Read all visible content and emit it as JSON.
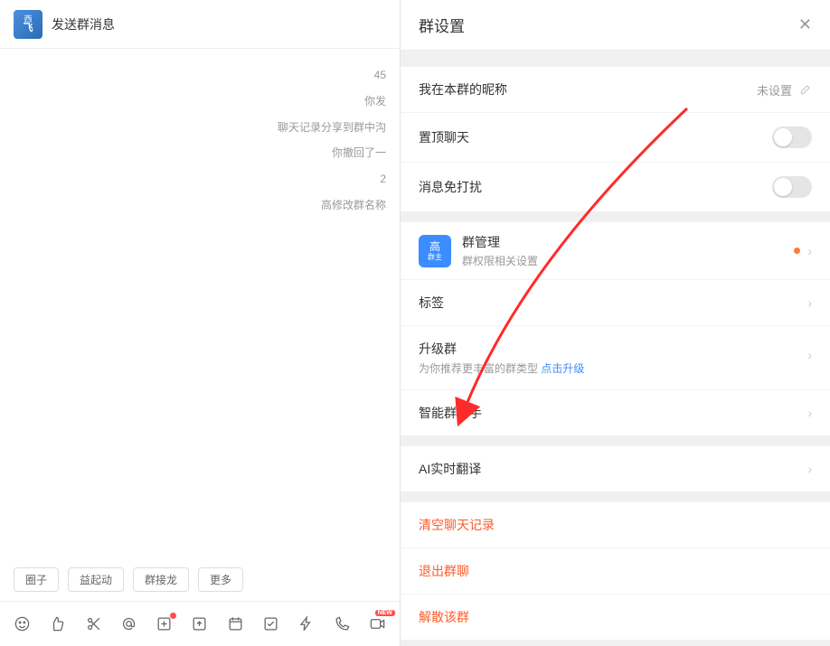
{
  "chat": {
    "title": "发送群消息",
    "avatar_lines": [
      "西",
      "飞"
    ],
    "messages": [
      "45",
      "你发",
      "聊天记录分享到群中沟",
      "你撤回了一",
      "2",
      "高修改群名称"
    ],
    "chips": [
      "圈子",
      "益起动",
      "群接龙",
      "更多"
    ]
  },
  "panel": {
    "title": "群设置",
    "nickname": {
      "label": "我在本群的昵称",
      "value": "未设置"
    },
    "pin_top": {
      "label": "置顶聊天"
    },
    "mute": {
      "label": "消息免打扰"
    },
    "group_mgmt": {
      "badge_top": "高",
      "badge_small": "群主",
      "title": "群管理",
      "subtitle": "群权限相关设置"
    },
    "tags": {
      "label": "标签"
    },
    "upgrade": {
      "label": "升级群",
      "subtitle_prefix": "为你推荐更丰富的群类型 ",
      "link": "点击升级"
    },
    "assistant": {
      "label": "智能群助手"
    },
    "translate": {
      "label": "AI实时翻译"
    },
    "danger": {
      "clear": "清空聊天记录",
      "leave": "退出群聊",
      "disband": "解散该群"
    }
  }
}
